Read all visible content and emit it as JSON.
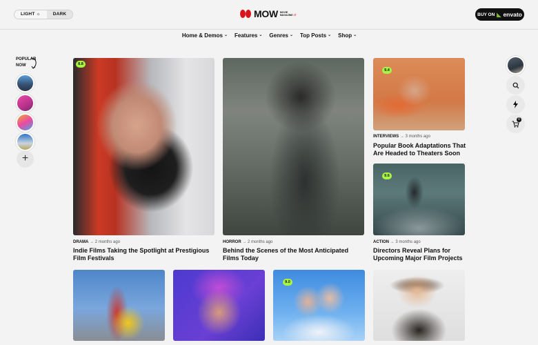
{
  "theme_toggle": {
    "light": "LIGHT",
    "light_icon": "☼",
    "dark": "DARK"
  },
  "logo": {
    "word": "MOW",
    "sub1": "MOVIE",
    "sub2": "MAGAZINE",
    "sub3": "JT"
  },
  "buy_button": {
    "prefix": "BUY ON",
    "brand": "envato",
    "icon": "leaf-icon"
  },
  "nav": {
    "items": [
      {
        "label": "Home & Demos"
      },
      {
        "label": "Features"
      },
      {
        "label": "Genres"
      },
      {
        "label": "Top Posts"
      },
      {
        "label": "Shop"
      }
    ]
  },
  "sidebar_left": {
    "heading_line1": "POPULAR",
    "heading_line2": "NOW",
    "add_label": "+"
  },
  "sidebar_right": {
    "cart_count": "0"
  },
  "colors": {
    "accent": "#d8141c",
    "score_badge": "#a7f544",
    "button_dark": "#111111",
    "background": "#f3f3f3"
  },
  "posts": [
    {
      "score": "8.8",
      "category": "DRAMA",
      "time": "2 months ago",
      "title": "Indie Films Taking the Spotlight at Prestigious Film Festivals"
    },
    {
      "category": "HORROR",
      "time": "2 months ago",
      "title": "Behind the Scenes of the Most Anticipated Films Today"
    },
    {
      "score": "9.4",
      "category": "INTERVIEWS",
      "time": "3 months ago",
      "title": "Popular Book Adaptations That Are Headed to Theaters Soon"
    },
    {
      "score": "9.6",
      "category": "ACTION",
      "time": "3 months ago",
      "title": "Directors Reveal Plans for Upcoming Major Film Projects"
    },
    {},
    {},
    {
      "score": "9.0"
    },
    {}
  ]
}
